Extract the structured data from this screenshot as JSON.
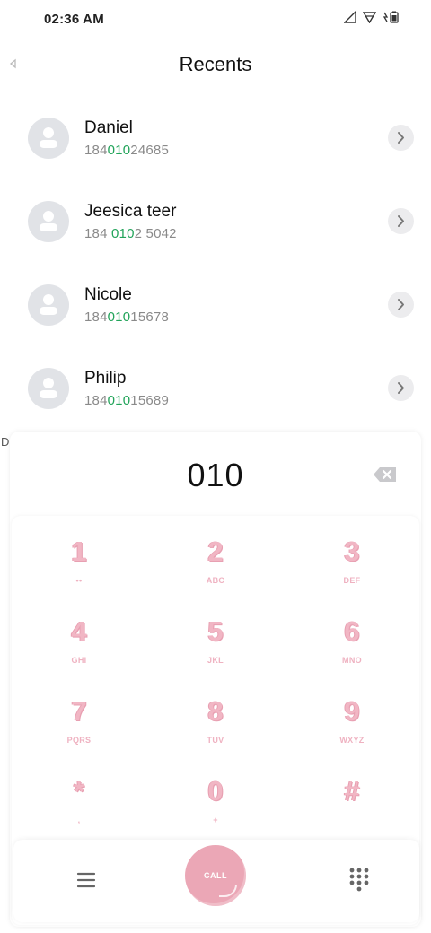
{
  "status_bar": {
    "time": "02:36 AM"
  },
  "header": {
    "title": "Recents"
  },
  "contacts": [
    {
      "name": "Daniel",
      "number_pre": "184",
      "number_match": "010",
      "number_post": "24685"
    },
    {
      "name": "Jeesica teer",
      "number_pre": "184 ",
      "number_match": "010",
      "number_post": "2 5042"
    },
    {
      "name": "Nicole",
      "number_pre": "184",
      "number_match": "010",
      "number_post": "15678"
    },
    {
      "name": "Philip",
      "number_pre": "184",
      "number_match": "010",
      "number_post": "15689"
    }
  ],
  "side_mark": "D",
  "dialer": {
    "entered": "010",
    "keys": [
      {
        "digit": "1",
        "letters": "••"
      },
      {
        "digit": "2",
        "letters": "ABC"
      },
      {
        "digit": "3",
        "letters": "DEF"
      },
      {
        "digit": "4",
        "letters": "GHI"
      },
      {
        "digit": "5",
        "letters": "JKL"
      },
      {
        "digit": "6",
        "letters": "MNO"
      },
      {
        "digit": "7",
        "letters": "PQRS"
      },
      {
        "digit": "8",
        "letters": "TUV"
      },
      {
        "digit": "9",
        "letters": "WXYZ"
      },
      {
        "digit": "*",
        "letters": ","
      },
      {
        "digit": "0",
        "letters": "+"
      },
      {
        "digit": "#",
        "letters": ""
      }
    ],
    "call_label": "CALL"
  },
  "colors": {
    "match": "#22a45a",
    "accent": "#eba7b6"
  },
  "icons": [
    "signal-icon",
    "wifi-icon",
    "battery-icon",
    "back-icon",
    "avatar-icon",
    "chevron-right-icon",
    "backspace-icon",
    "menu-icon",
    "dialpad-icon"
  ]
}
